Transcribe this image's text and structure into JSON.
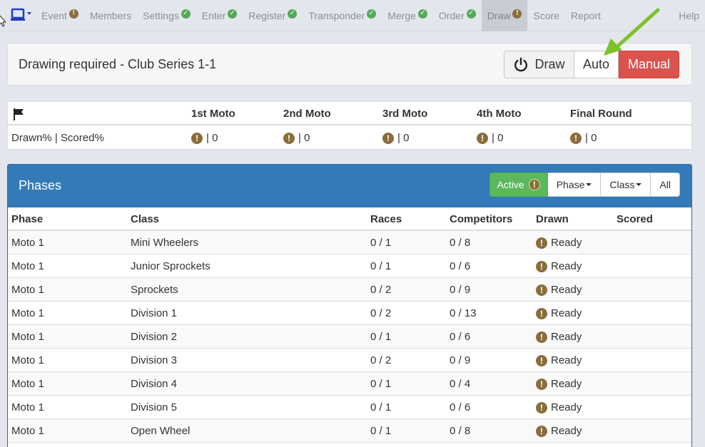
{
  "nav": {
    "logo_icon": "monitor-dropdown-icon",
    "items": [
      {
        "label": "Event",
        "badge": "warn"
      },
      {
        "label": "Members",
        "badge": ""
      },
      {
        "label": "Settings",
        "badge": "ok"
      },
      {
        "label": "Enter",
        "badge": "ok"
      },
      {
        "label": "Register",
        "badge": "ok"
      },
      {
        "label": "Transponder",
        "badge": "ok"
      },
      {
        "label": "Merge",
        "badge": "ok"
      },
      {
        "label": "Order",
        "badge": "ok"
      },
      {
        "label": "Draw",
        "badge": "warn",
        "active": true
      },
      {
        "label": "Score",
        "badge": ""
      },
      {
        "label": "Report",
        "badge": ""
      }
    ],
    "help": "Help"
  },
  "status": {
    "message": "Drawing required - Club Series 1-1",
    "draw_label": "Draw",
    "auto_label": "Auto",
    "manual_label": "Manual"
  },
  "moto_summary": {
    "row_label": "Drawn% | Scored%",
    "columns": [
      {
        "label": "1st Moto",
        "value": "| 0"
      },
      {
        "label": "2nd Moto",
        "value": "| 0"
      },
      {
        "label": "3rd Moto",
        "value": "| 0"
      },
      {
        "label": "4th Moto",
        "value": "| 0"
      },
      {
        "label": "Final Round",
        "value": "| 0"
      }
    ]
  },
  "phases": {
    "title": "Phases",
    "filters": {
      "active": "Active",
      "phase": "Phase",
      "class": "Class",
      "all": "All"
    },
    "columns": [
      "Phase",
      "Class",
      "Races",
      "Competitors",
      "Drawn",
      "Scored"
    ],
    "rows": [
      {
        "phase": "Moto 1",
        "class": "Mini Wheelers",
        "races": "0 / 1",
        "competitors": "0 / 8",
        "drawn": "Ready",
        "scored": ""
      },
      {
        "phase": "Moto 1",
        "class": "Junior Sprockets",
        "races": "0 / 1",
        "competitors": "0 / 6",
        "drawn": "Ready",
        "scored": ""
      },
      {
        "phase": "Moto 1",
        "class": "Sprockets",
        "races": "0 / 2",
        "competitors": "0 / 9",
        "drawn": "Ready",
        "scored": ""
      },
      {
        "phase": "Moto 1",
        "class": "Division 1",
        "races": "0 / 2",
        "competitors": "0 / 13",
        "drawn": "Ready",
        "scored": ""
      },
      {
        "phase": "Moto 1",
        "class": "Division 2",
        "races": "0 / 1",
        "competitors": "0 / 6",
        "drawn": "Ready",
        "scored": ""
      },
      {
        "phase": "Moto 1",
        "class": "Division 3",
        "races": "0 / 2",
        "competitors": "0 / 9",
        "drawn": "Ready",
        "scored": ""
      },
      {
        "phase": "Moto 1",
        "class": "Division 4",
        "races": "0 / 1",
        "competitors": "0 / 4",
        "drawn": "Ready",
        "scored": ""
      },
      {
        "phase": "Moto 1",
        "class": "Division 5",
        "races": "0 / 1",
        "competitors": "0 / 6",
        "drawn": "Ready",
        "scored": ""
      },
      {
        "phase": "Moto 1",
        "class": "Open Wheel",
        "races": "0 / 1",
        "competitors": "0 / 8",
        "drawn": "Ready",
        "scored": ""
      }
    ]
  },
  "colors": {
    "primary": "#337ab7",
    "success": "#5cb85c",
    "danger": "#d9534f",
    "warning_badge": "#8a6d3b",
    "ok_badge": "#53a957",
    "arrow": "#7cc22a"
  }
}
